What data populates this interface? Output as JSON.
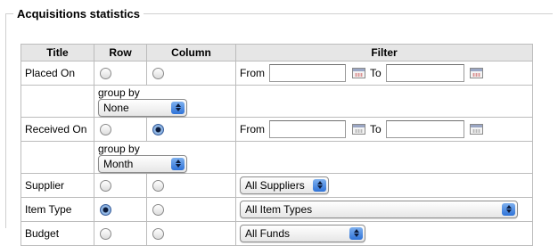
{
  "legend": "Acquisitions statistics",
  "headers": {
    "title": "Title",
    "row": "Row",
    "column": "Column",
    "filter": "Filter"
  },
  "rows": {
    "placed_on": {
      "label": "Placed On",
      "from_label": "From",
      "to_label": "To",
      "group_by_label": "group by",
      "group_by_value": "None",
      "row_selected": false,
      "column_selected": false
    },
    "received_on": {
      "label": "Received On",
      "from_label": "From",
      "to_label": "To",
      "group_by_label": "group by",
      "group_by_value": "Month",
      "row_selected": false,
      "column_selected": true
    },
    "supplier": {
      "label": "Supplier",
      "filter_value": "All Suppliers",
      "row_selected": false,
      "column_selected": false
    },
    "item_type": {
      "label": "Item Type",
      "filter_value": "All Item Types",
      "row_selected": true,
      "column_selected": false
    },
    "budget": {
      "label": "Budget",
      "filter_value": "All Funds",
      "row_selected": false,
      "column_selected": false
    }
  },
  "icons": {
    "calendar": "calendar-icon",
    "stepper": "select-stepper-icon"
  },
  "colors": {
    "header_bg": "#e6e6e6",
    "border": "#bcbcbc",
    "stepper_blue": "#2f73d8"
  }
}
